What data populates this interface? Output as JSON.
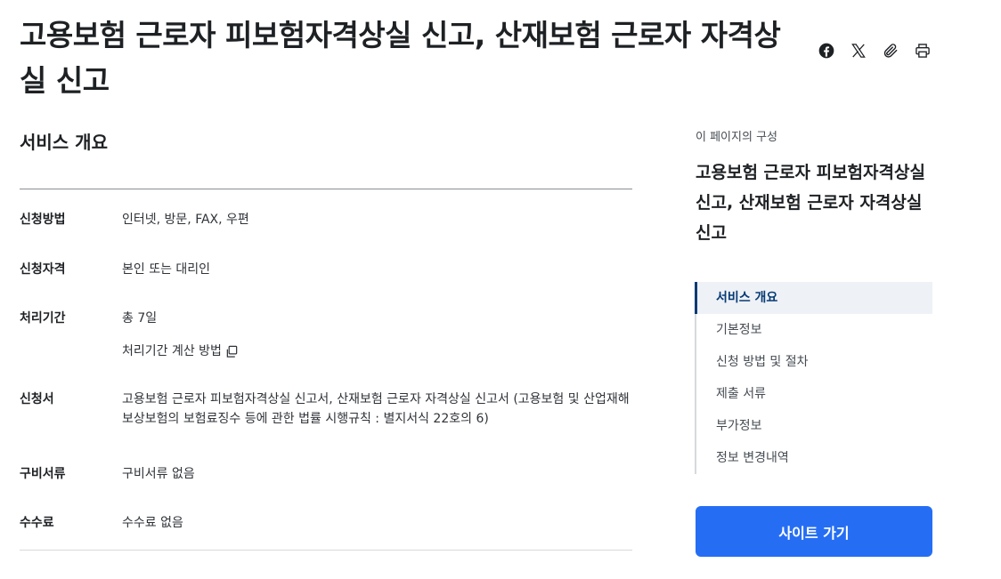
{
  "page": {
    "title": "고용보험 근로자 피보험자격상실 신고, 산재보험 근로자 자격상실 신고"
  },
  "share": {
    "icons": [
      "facebook-icon",
      "x-icon",
      "paperclip-icon",
      "print-icon"
    ]
  },
  "overview": {
    "section_title": "서비스 개요",
    "rows": [
      {
        "label": "신청방법",
        "value": "인터넷, 방문, FAX, 우편"
      },
      {
        "label": "신청자격",
        "value": "본인 또는 대리인"
      },
      {
        "label": "처리기간",
        "value": "총 7일",
        "link": "처리기간 계산 방법"
      },
      {
        "label": "신청서",
        "value": "고용보험 근로자 피보험자격상실 신고서, 산재보험 근로자 자격상실 신고서 (고용보험 및 산업재해보상보험의 보험료징수 등에 관한 법률 시행규칙 : 별지서식 22호의 6)"
      },
      {
        "label": "구비서류",
        "value": "구비서류 없음"
      },
      {
        "label": "수수료",
        "value": "수수료 없음"
      }
    ]
  },
  "toc": {
    "caption": "이 페이지의 구성",
    "title": "고용보험 근로자 피보험자격상실 신고, 산재보험 근로자 자격상실 신고",
    "items": [
      {
        "label": "서비스 개요",
        "active": true
      },
      {
        "label": "기본정보"
      },
      {
        "label": "신청 방법 및 절차"
      },
      {
        "label": "제출 서류"
      },
      {
        "label": "부가정보"
      },
      {
        "label": "정보 변경내역"
      }
    ]
  },
  "cta": {
    "label": "사이트 가기"
  },
  "colors": {
    "accent": "#256ef4",
    "active_nav": "#063a74",
    "active_bg": "#eef1f6"
  }
}
